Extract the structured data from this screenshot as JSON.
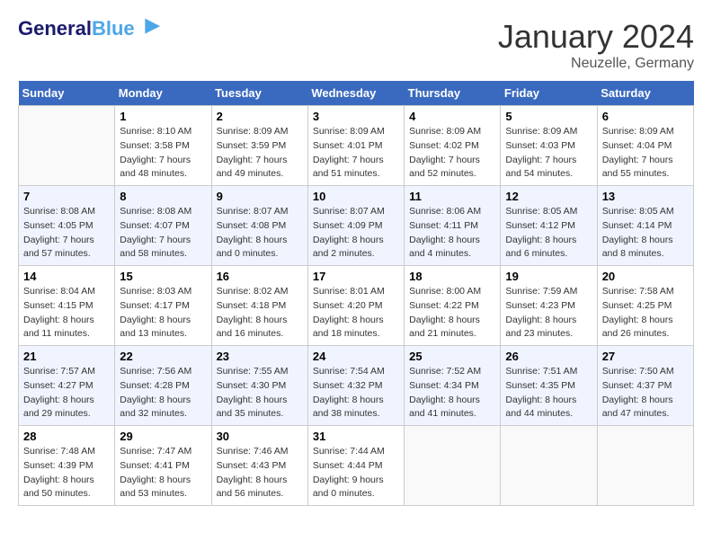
{
  "header": {
    "logo_line1": "General",
    "logo_line2": "Blue",
    "month": "January 2024",
    "location": "Neuzelle, Germany"
  },
  "weekdays": [
    "Sunday",
    "Monday",
    "Tuesday",
    "Wednesday",
    "Thursday",
    "Friday",
    "Saturday"
  ],
  "weeks": [
    [
      {
        "day": "",
        "sunrise": "",
        "sunset": "",
        "daylight": ""
      },
      {
        "day": "1",
        "sunrise": "Sunrise: 8:10 AM",
        "sunset": "Sunset: 3:58 PM",
        "daylight": "Daylight: 7 hours and 48 minutes."
      },
      {
        "day": "2",
        "sunrise": "Sunrise: 8:09 AM",
        "sunset": "Sunset: 3:59 PM",
        "daylight": "Daylight: 7 hours and 49 minutes."
      },
      {
        "day": "3",
        "sunrise": "Sunrise: 8:09 AM",
        "sunset": "Sunset: 4:01 PM",
        "daylight": "Daylight: 7 hours and 51 minutes."
      },
      {
        "day": "4",
        "sunrise": "Sunrise: 8:09 AM",
        "sunset": "Sunset: 4:02 PM",
        "daylight": "Daylight: 7 hours and 52 minutes."
      },
      {
        "day": "5",
        "sunrise": "Sunrise: 8:09 AM",
        "sunset": "Sunset: 4:03 PM",
        "daylight": "Daylight: 7 hours and 54 minutes."
      },
      {
        "day": "6",
        "sunrise": "Sunrise: 8:09 AM",
        "sunset": "Sunset: 4:04 PM",
        "daylight": "Daylight: 7 hours and 55 minutes."
      }
    ],
    [
      {
        "day": "7",
        "sunrise": "Sunrise: 8:08 AM",
        "sunset": "Sunset: 4:05 PM",
        "daylight": "Daylight: 7 hours and 57 minutes."
      },
      {
        "day": "8",
        "sunrise": "Sunrise: 8:08 AM",
        "sunset": "Sunset: 4:07 PM",
        "daylight": "Daylight: 7 hours and 58 minutes."
      },
      {
        "day": "9",
        "sunrise": "Sunrise: 8:07 AM",
        "sunset": "Sunset: 4:08 PM",
        "daylight": "Daylight: 8 hours and 0 minutes."
      },
      {
        "day": "10",
        "sunrise": "Sunrise: 8:07 AM",
        "sunset": "Sunset: 4:09 PM",
        "daylight": "Daylight: 8 hours and 2 minutes."
      },
      {
        "day": "11",
        "sunrise": "Sunrise: 8:06 AM",
        "sunset": "Sunset: 4:11 PM",
        "daylight": "Daylight: 8 hours and 4 minutes."
      },
      {
        "day": "12",
        "sunrise": "Sunrise: 8:05 AM",
        "sunset": "Sunset: 4:12 PM",
        "daylight": "Daylight: 8 hours and 6 minutes."
      },
      {
        "day": "13",
        "sunrise": "Sunrise: 8:05 AM",
        "sunset": "Sunset: 4:14 PM",
        "daylight": "Daylight: 8 hours and 8 minutes."
      }
    ],
    [
      {
        "day": "14",
        "sunrise": "Sunrise: 8:04 AM",
        "sunset": "Sunset: 4:15 PM",
        "daylight": "Daylight: 8 hours and 11 minutes."
      },
      {
        "day": "15",
        "sunrise": "Sunrise: 8:03 AM",
        "sunset": "Sunset: 4:17 PM",
        "daylight": "Daylight: 8 hours and 13 minutes."
      },
      {
        "day": "16",
        "sunrise": "Sunrise: 8:02 AM",
        "sunset": "Sunset: 4:18 PM",
        "daylight": "Daylight: 8 hours and 16 minutes."
      },
      {
        "day": "17",
        "sunrise": "Sunrise: 8:01 AM",
        "sunset": "Sunset: 4:20 PM",
        "daylight": "Daylight: 8 hours and 18 minutes."
      },
      {
        "day": "18",
        "sunrise": "Sunrise: 8:00 AM",
        "sunset": "Sunset: 4:22 PM",
        "daylight": "Daylight: 8 hours and 21 minutes."
      },
      {
        "day": "19",
        "sunrise": "Sunrise: 7:59 AM",
        "sunset": "Sunset: 4:23 PM",
        "daylight": "Daylight: 8 hours and 23 minutes."
      },
      {
        "day": "20",
        "sunrise": "Sunrise: 7:58 AM",
        "sunset": "Sunset: 4:25 PM",
        "daylight": "Daylight: 8 hours and 26 minutes."
      }
    ],
    [
      {
        "day": "21",
        "sunrise": "Sunrise: 7:57 AM",
        "sunset": "Sunset: 4:27 PM",
        "daylight": "Daylight: 8 hours and 29 minutes."
      },
      {
        "day": "22",
        "sunrise": "Sunrise: 7:56 AM",
        "sunset": "Sunset: 4:28 PM",
        "daylight": "Daylight: 8 hours and 32 minutes."
      },
      {
        "day": "23",
        "sunrise": "Sunrise: 7:55 AM",
        "sunset": "Sunset: 4:30 PM",
        "daylight": "Daylight: 8 hours and 35 minutes."
      },
      {
        "day": "24",
        "sunrise": "Sunrise: 7:54 AM",
        "sunset": "Sunset: 4:32 PM",
        "daylight": "Daylight: 8 hours and 38 minutes."
      },
      {
        "day": "25",
        "sunrise": "Sunrise: 7:52 AM",
        "sunset": "Sunset: 4:34 PM",
        "daylight": "Daylight: 8 hours and 41 minutes."
      },
      {
        "day": "26",
        "sunrise": "Sunrise: 7:51 AM",
        "sunset": "Sunset: 4:35 PM",
        "daylight": "Daylight: 8 hours and 44 minutes."
      },
      {
        "day": "27",
        "sunrise": "Sunrise: 7:50 AM",
        "sunset": "Sunset: 4:37 PM",
        "daylight": "Daylight: 8 hours and 47 minutes."
      }
    ],
    [
      {
        "day": "28",
        "sunrise": "Sunrise: 7:48 AM",
        "sunset": "Sunset: 4:39 PM",
        "daylight": "Daylight: 8 hours and 50 minutes."
      },
      {
        "day": "29",
        "sunrise": "Sunrise: 7:47 AM",
        "sunset": "Sunset: 4:41 PM",
        "daylight": "Daylight: 8 hours and 53 minutes."
      },
      {
        "day": "30",
        "sunrise": "Sunrise: 7:46 AM",
        "sunset": "Sunset: 4:43 PM",
        "daylight": "Daylight: 8 hours and 56 minutes."
      },
      {
        "day": "31",
        "sunrise": "Sunrise: 7:44 AM",
        "sunset": "Sunset: 4:44 PM",
        "daylight": "Daylight: 9 hours and 0 minutes."
      },
      {
        "day": "",
        "sunrise": "",
        "sunset": "",
        "daylight": ""
      },
      {
        "day": "",
        "sunrise": "",
        "sunset": "",
        "daylight": ""
      },
      {
        "day": "",
        "sunrise": "",
        "sunset": "",
        "daylight": ""
      }
    ]
  ]
}
